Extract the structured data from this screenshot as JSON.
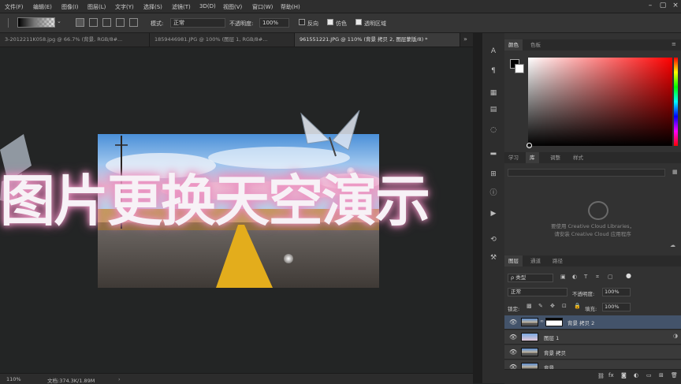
{
  "menu": {
    "items": [
      "文件(F)",
      "编辑(E)",
      "图像(I)",
      "图层(L)",
      "文字(Y)",
      "选择(S)",
      "滤镜(T)",
      "3D(D)",
      "视图(V)",
      "窗口(W)",
      "帮助(H)"
    ]
  },
  "options": {
    "mode_label": "模式:",
    "mode_value": "正常",
    "opacity_label": "不透明度:",
    "opacity_value": "100%",
    "reverse_label": "反向",
    "dither_label": "仿色",
    "transparency_label": "透明区域",
    "reverse_checked": false,
    "dither_checked": true,
    "transparency_checked": true
  },
  "tabs": [
    {
      "label": "3-2012211K058.jpg @ 66.7% (背景, RGB/8#..."
    },
    {
      "label": "1859446981.JPG @ 100% (图层 1, RGB/8#..."
    },
    {
      "label": "961551221.JPG @ 110% (背景 拷贝 2, 图层蒙版/8) *"
    }
  ],
  "canvas": {
    "overlay_text": "图片更换天空演示"
  },
  "status": {
    "zoom": "110%",
    "doc_info": "文档:374.3K/1.89M"
  },
  "color_panel": {
    "tabs": [
      "颜色",
      "色板"
    ],
    "hue_color": "#ff0000"
  },
  "library_panel": {
    "tabs": [
      "学习",
      "库",
      "调整",
      "样式"
    ],
    "message_line1": "要使用 Creative Cloud Libraries，",
    "message_line2": "请安装 Creative Cloud 应用程序"
  },
  "layers_panel": {
    "tabs": [
      "图层",
      "通道",
      "路径"
    ],
    "filter_label": "ρ 类型",
    "blend_mode": "正常",
    "opacity_label": "不透明度:",
    "opacity_value": "100%",
    "lock_label": "锁定:",
    "fill_label": "填充:",
    "fill_value": "100%",
    "layers": [
      {
        "name": "背景 拷贝 2",
        "selected": true
      },
      {
        "name": "图层 1",
        "selected": false
      },
      {
        "name": "背景 拷贝",
        "selected": false
      },
      {
        "name": "背景",
        "selected": false
      }
    ]
  }
}
